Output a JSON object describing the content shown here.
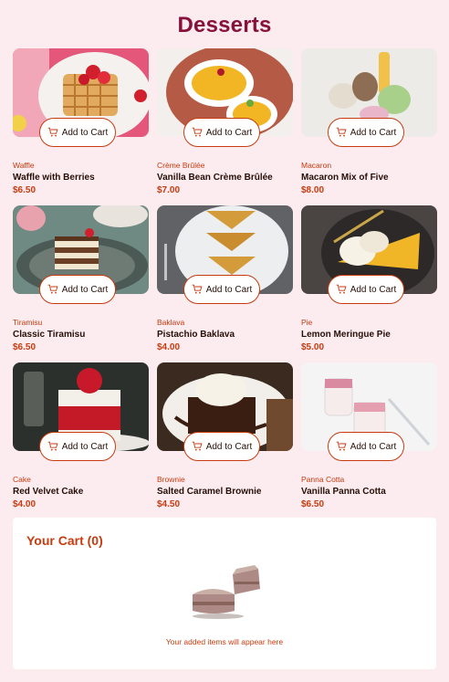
{
  "page": {
    "title": "Desserts"
  },
  "add_to_cart_label": "Add to Cart",
  "products": [
    {
      "category": "Waffle",
      "name": "Waffle with Berries",
      "price": "$6.50"
    },
    {
      "category": "Crème Brûlée",
      "name": "Vanilla Bean Crème Brûlée",
      "price": "$7.00"
    },
    {
      "category": "Macaron",
      "name": "Macaron Mix of Five",
      "price": "$8.00"
    },
    {
      "category": "Tiramisu",
      "name": "Classic Tiramisu",
      "price": "$6.50"
    },
    {
      "category": "Baklava",
      "name": "Pistachio Baklava",
      "price": "$4.00"
    },
    {
      "category": "Pie",
      "name": "Lemon Meringue Pie",
      "price": "$5.00"
    },
    {
      "category": "Cake",
      "name": "Red Velvet Cake",
      "price": "$4.00"
    },
    {
      "category": "Brownie",
      "name": "Salted Caramel Brownie",
      "price": "$4.50"
    },
    {
      "category": "Panna Cotta",
      "name": "Vanilla Panna Cotta",
      "price": "$6.50"
    }
  ],
  "cart": {
    "title": "Your Cart (0)",
    "empty_message": "Your added items will appear here"
  },
  "colors": {
    "accent": "#c73b0f",
    "title": "#87113a",
    "background": "#fcebef"
  }
}
